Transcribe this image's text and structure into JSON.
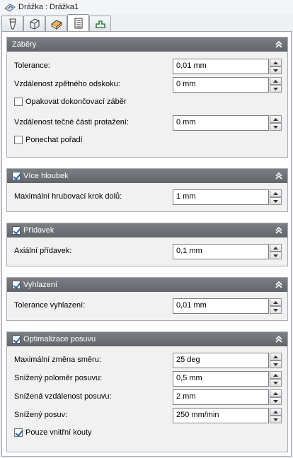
{
  "window": {
    "title": "Drážka : Drážka1"
  },
  "tabs": [
    {
      "icon": "tool-icon"
    },
    {
      "icon": "stock-icon"
    },
    {
      "icon": "setup-icon"
    },
    {
      "icon": "passes-icon"
    },
    {
      "icon": "linking-icon"
    }
  ],
  "groups": {
    "zabery": {
      "title": "Záběry",
      "tolerance": {
        "label": "Tolerance:",
        "value": "0,01 mm"
      },
      "springback": {
        "label": "Vzdálenost zpětného odskoku:",
        "value": "0 mm"
      },
      "repeat_finish": {
        "label": "Opakovat dokončovací záběr",
        "checked": false
      },
      "tangent_ext": {
        "label": "Vzdálenost tečné části protažení:",
        "value": "0 mm"
      },
      "keep_order": {
        "label": "Ponechat pořadí",
        "checked": false
      }
    },
    "vice_hloubek": {
      "title": "Více hloubek",
      "checked": true,
      "max_roughing": {
        "label": "Maximální hrubovací krok dolů:",
        "value": "1 mm"
      }
    },
    "pridavek": {
      "title": "Přídavek",
      "checked": true,
      "axial": {
        "label": "Axiální přídavek:",
        "value": "0,1 mm"
      }
    },
    "vyhlazeni": {
      "title": "Vyhlazení",
      "checked": true,
      "tolerance": {
        "label": "Tolerance vyhlazení:",
        "value": "0,01 mm"
      }
    },
    "optimalizace": {
      "title": "Optimalizace posuvu",
      "checked": true,
      "max_dir_change": {
        "label": "Maximální změna směru:",
        "value": "25 deg"
      },
      "reduced_radius": {
        "label": "Snížený poloměr posuvu:",
        "value": "0,5 mm"
      },
      "reduced_distance": {
        "label": "Snížená vzdálenost posuvu:",
        "value": "2 mm"
      },
      "reduced_feed": {
        "label": "Snížený posuv:",
        "value": "250 mm/min"
      },
      "inner_corners": {
        "label": "Pouze vnitřní kouty",
        "checked": true
      }
    }
  }
}
